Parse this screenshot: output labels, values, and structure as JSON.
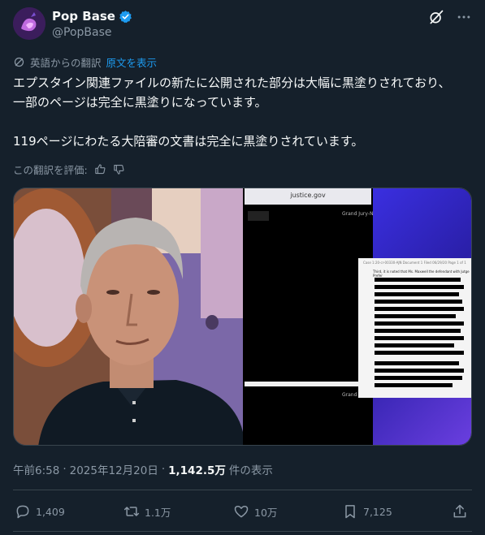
{
  "user": {
    "display_name": "Pop Base",
    "handle": "@PopBase",
    "verified": true,
    "avatar_icon": "pop-base-logo"
  },
  "translation": {
    "from_label": "英語からの翻訳",
    "show_original": "原文を表示",
    "rate_label": "この翻訳を評価:"
  },
  "tweet": {
    "lines": [
      "エプスタイン関連ファイルの新たに公開された部分は大幅に黒塗りされており、",
      "一部のページは完全に黒塗りになっています。",
      "119ページにわたる大陪審の文書は完全に黒塗りされています。"
    ]
  },
  "media": {
    "url": "justice.gov",
    "label_top": "Grand Jury-NY",
    "label_bottom": "Grand",
    "doc_caption": "Case 1:20-cr-00330-AJN  Document 1  Filed 06/29/20  Page 1 of 1",
    "doc_first_line": "Third, it is noted that Ms. Maxwell the defendant with Jutge Prefer"
  },
  "meta": {
    "time": "午前6:58",
    "date": "2025年12月20日",
    "views": "1,142.5万",
    "views_label": "件の表示"
  },
  "stats": {
    "replies": "1,409",
    "reposts": "1.1万",
    "likes": "10万",
    "bookmarks": "7,125"
  },
  "colors": {
    "background": "#15202b",
    "accent": "#1d9bf0",
    "secondary_text": "#8b98a5",
    "divider": "#38444d"
  }
}
